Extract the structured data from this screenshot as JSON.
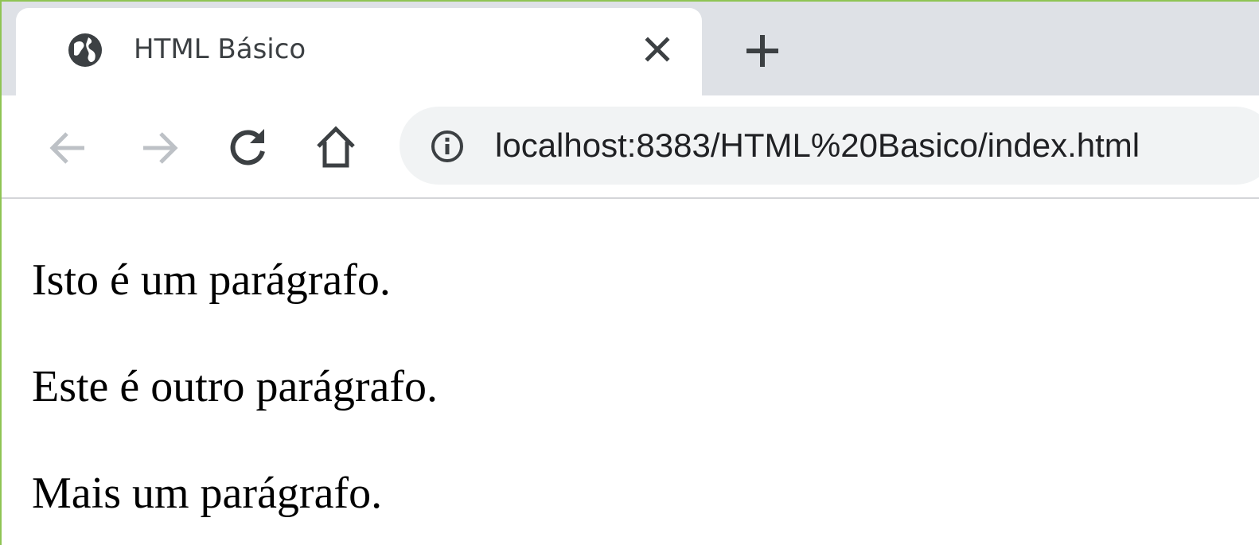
{
  "browser": {
    "tab": {
      "title": "HTML Básico",
      "favicon": "globe-icon",
      "close_icon": "close-icon"
    },
    "new_tab_icon": "plus-icon",
    "toolbar": {
      "back_icon": "arrow-left-icon",
      "forward_icon": "arrow-right-icon",
      "reload_icon": "reload-icon",
      "home_icon": "home-icon",
      "site_info_icon": "info-icon",
      "url": "localhost:8383/HTML%20Basico/index.html"
    },
    "colors": {
      "tabstrip": "#dee1e6",
      "omnibox": "#f1f3f4",
      "icon_active": "#3c4043",
      "icon_disabled": "#bdc1c6",
      "frame_border": "#8fc454"
    }
  },
  "page": {
    "paragraphs": [
      "Isto é um parágrafo.",
      "Este é outro parágrafo.",
      "Mais um parágrafo."
    ]
  }
}
